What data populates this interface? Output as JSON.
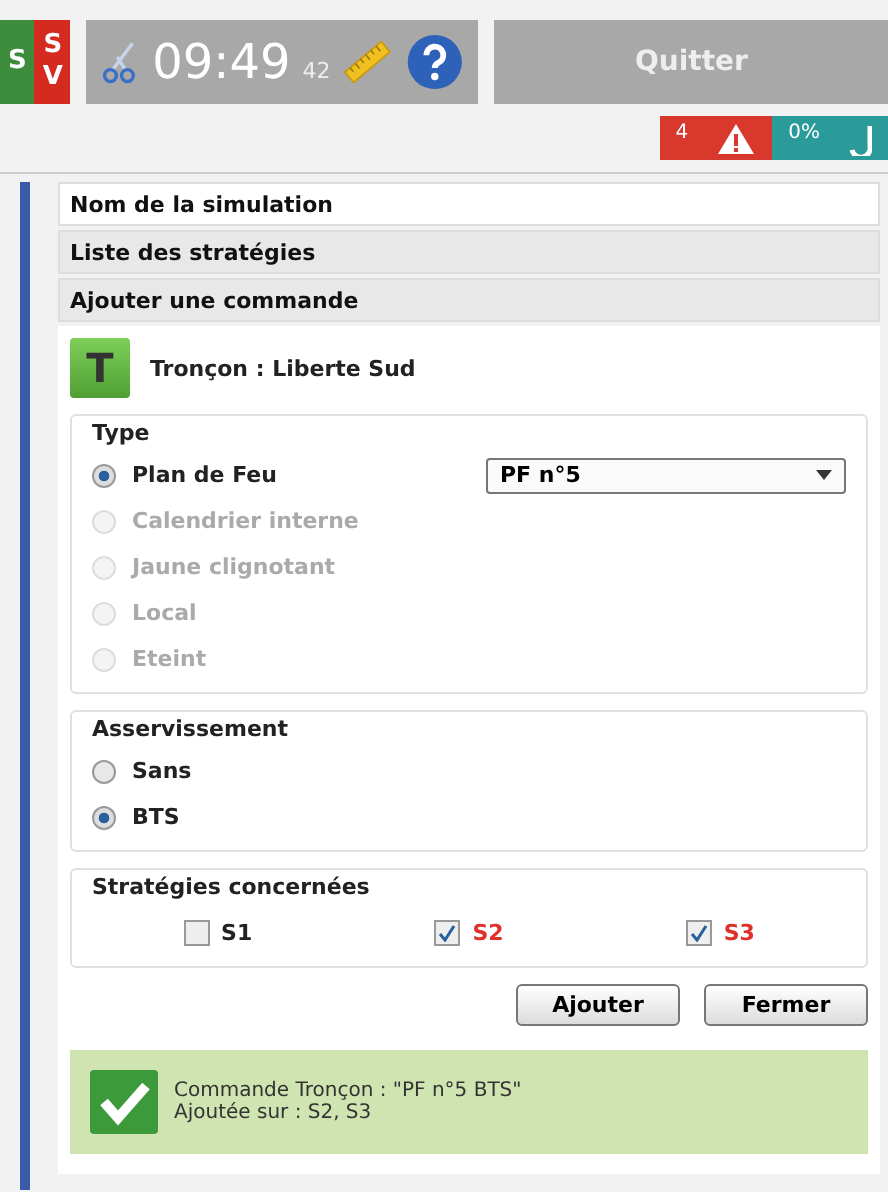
{
  "top_bar": {
    "mode_tags": [
      {
        "lines": [
          "S"
        ],
        "color": "#3c8c3c"
      },
      {
        "lines": [
          "S",
          "V"
        ],
        "color": "#d42a20"
      }
    ],
    "clock": {
      "time": "09:49",
      "seconds": "42"
    },
    "quit_button": "Quitter"
  },
  "alerts": [
    {
      "kind": "warning",
      "text": "4",
      "color": "#d9382c"
    },
    {
      "kind": "progress",
      "text": "0%",
      "color": "#2a9a9a"
    }
  ],
  "sections": [
    "Nom de la simulation",
    "Liste des stratégies",
    "Ajouter une commande"
  ],
  "command": {
    "badge": "T",
    "label": "Tronçon : Liberte Sud",
    "type_group": {
      "title": "Type",
      "select_value": "PF n°5",
      "options": [
        {
          "label": "Plan de Feu",
          "selected": true,
          "disabled": false
        },
        {
          "label": "Calendrier interne",
          "selected": false,
          "disabled": true
        },
        {
          "label": "Jaune clignotant",
          "selected": false,
          "disabled": true
        },
        {
          "label": "Local",
          "selected": false,
          "disabled": true
        },
        {
          "label": "Eteint",
          "selected": false,
          "disabled": true
        }
      ]
    },
    "servo_group": {
      "title": "Asservissement",
      "options": [
        {
          "label": "Sans",
          "selected": false,
          "disabled": false
        },
        {
          "label": "BTS",
          "selected": true,
          "disabled": false
        }
      ]
    },
    "strategies_group": {
      "title": "Stratégies concernées",
      "items": [
        {
          "label": "S1",
          "checked": false
        },
        {
          "label": "S2",
          "checked": true
        },
        {
          "label": "S3",
          "checked": true
        }
      ]
    },
    "buttons": [
      "Ajouter",
      "Fermer"
    ],
    "message": {
      "lines": [
        "Commande Tronçon : \"PF n°5 BTS\"",
        "Ajoutée sur : S2, S3"
      ]
    }
  }
}
